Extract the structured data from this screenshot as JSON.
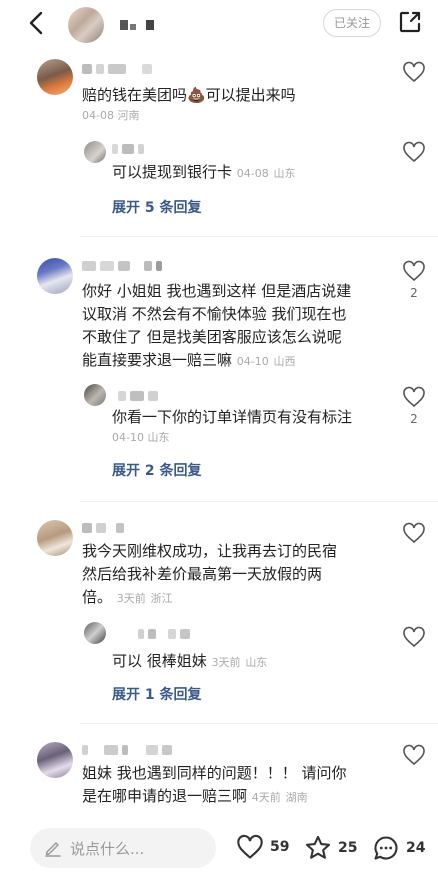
{
  "header": {
    "follow_label": "已关注"
  },
  "comments": [
    {
      "text": "赔的钱在美团吗💩可以提出来吗",
      "date": "04-08",
      "region": "河南",
      "reply": {
        "text": "可以提现到银行卡",
        "date": "04-08",
        "region": "山东"
      },
      "expand": "展开 5 条回复"
    },
    {
      "text_lines": [
        "你好 小姐姐 我也遇到这样 但是酒店说建",
        "议取消 不然会有不愉快体验 我们现在也",
        "不敢住了 但是找美团客服应该怎么说呢",
        "能直接要求退一赔三嘛"
      ],
      "date": "04-10",
      "region": "山西",
      "likes": "2",
      "reply": {
        "text": "你看一下你的订单详情页有没有标注",
        "date": "04-10",
        "region": "山东",
        "likes": "2"
      },
      "expand": "展开 2 条回复"
    },
    {
      "text_lines": [
        "我今天刚维权成功，让我再去订的民宿",
        "然后给我补差价最高第一天放假的两",
        "倍。"
      ],
      "date": "3天前",
      "region": "浙江",
      "reply": {
        "text": "可以 很棒姐妹",
        "date": "3天前",
        "region": "山东"
      },
      "expand": "展开 1 条回复"
    },
    {
      "text_lines": [
        "姐妹 我也遇到同样的问题！！！ 请问你",
        "是在哪申请的退一赔三啊"
      ],
      "date": "4天前",
      "region": "湖南"
    }
  ],
  "bottom": {
    "placeholder": "说点什么...",
    "likes": "59",
    "stars": "25",
    "comments": "24"
  }
}
